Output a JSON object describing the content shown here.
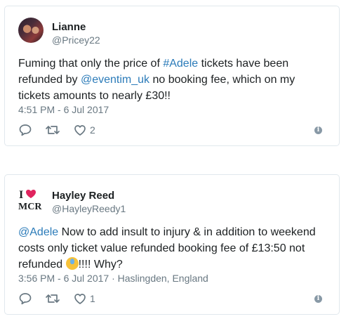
{
  "tweets": [
    {
      "name": "Lianne",
      "handle": "@Pricey22",
      "text_parts": {
        "p1": "Fuming that only the price of ",
        "hashtag": "#Adele",
        "p2": " tickets have been refunded by ",
        "mention": "@eventim_uk",
        "p3": " no booking fee, which on my tickets amounts to nearly £30!!"
      },
      "timestamp": "4:51 PM - 6 Jul 2017",
      "like_count": "2"
    },
    {
      "name": "Hayley Reed",
      "handle": "@HayleyReedy1",
      "avatar_text": {
        "line1": "I",
        "line2": "MCR"
      },
      "text_parts": {
        "mention": "@Adele",
        "p1": " Now to add insult to injury & in addition to weekend costs only ticket value refunded booking fee of £13:50 not refunded ",
        "p2": "!!!! Why?"
      },
      "timestamp": "3:56 PM - 6 Jul 2017",
      "location": " · Haslingden, England",
      "like_count": "1"
    }
  ],
  "icons": {
    "reply": "reply-icon",
    "retweet": "retweet-icon",
    "like": "heart-icon",
    "info": "info-icon"
  },
  "colors": {
    "link": "#2b7bb9",
    "muted": "#697882",
    "border": "#e1e8ed"
  }
}
